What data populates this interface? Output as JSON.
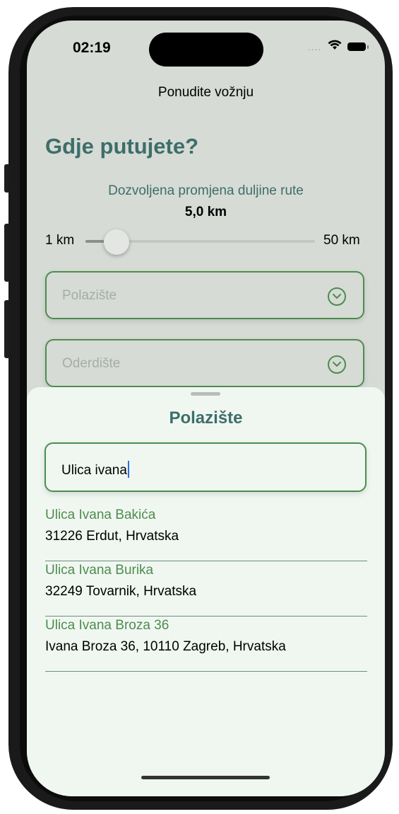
{
  "status_bar": {
    "time": "02:19",
    "signal": "....",
    "wifi_icon": "wifi-icon",
    "battery_icon": "battery-icon"
  },
  "nav": {
    "title": "Ponudite vožnju"
  },
  "heading": "Gdje putujete?",
  "route": {
    "label": "Dozvoljena promjena duljine rute",
    "value": "5,0 km",
    "min_label": "1 km",
    "max_label": "50 km",
    "slider_fraction": 0.08
  },
  "fields": {
    "origin_placeholder": "Polazište",
    "destination_placeholder": "Oderdište"
  },
  "sheet": {
    "title": "Polazište",
    "search_value": "Ulica ivana",
    "results": [
      {
        "title": "Ulica Ivana Bakića",
        "subtitle": "31226 Erdut, Hrvatska"
      },
      {
        "title": "Ulica Ivana Burika",
        "subtitle": "32249 Tovarnik, Hrvatska"
      },
      {
        "title": "Ulica Ivana Broza 36",
        "subtitle": "Ivana Broza 36, 10110 Zagreb, Hrvatska"
      }
    ]
  },
  "colors": {
    "accent": "#4e8c4e",
    "heading": "#3e6e69",
    "background": "#d6dbd6",
    "sheet": "#f0f7f1"
  }
}
